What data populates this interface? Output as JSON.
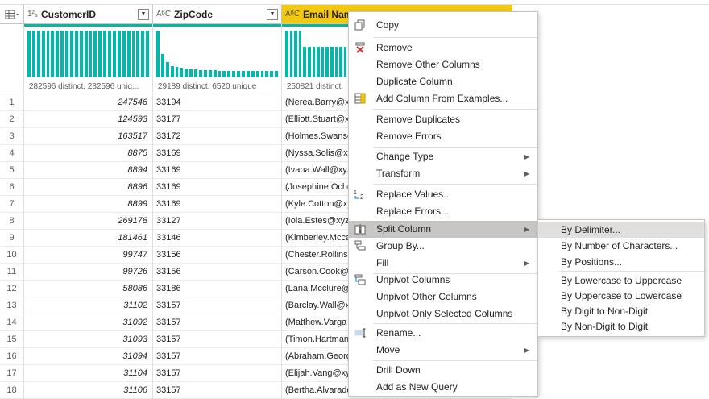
{
  "columns": [
    {
      "type_icon": "1²₃",
      "name": "CustomerID",
      "profile": "282596 distinct, 282596 uniq..."
    },
    {
      "type_icon": "AᴮC",
      "name": "ZipCode",
      "profile": "29189 distinct, 6520 unique"
    },
    {
      "type_icon": "AᴮC",
      "name": "Email Name",
      "profile": "250821 distinct, "
    }
  ],
  "rows": [
    {
      "n": "1",
      "id": "247546",
      "zip": "33194",
      "email": "(Nerea.Barry@xy"
    },
    {
      "n": "2",
      "id": "124593",
      "zip": "33177",
      "email": "(Elliott.Stuart@x"
    },
    {
      "n": "3",
      "id": "163517",
      "zip": "33172",
      "email": "(Holmes.Swanso"
    },
    {
      "n": "4",
      "id": "8875",
      "zip": "33169",
      "email": "(Nyssa.Solis@xyz"
    },
    {
      "n": "5",
      "id": "8894",
      "zip": "33169",
      "email": "(Ivana.Wall@xyz"
    },
    {
      "n": "6",
      "id": "8896",
      "zip": "33169",
      "email": "(Josephine.Ocho"
    },
    {
      "n": "7",
      "id": "8899",
      "zip": "33169",
      "email": "(Kyle.Cotton@xy"
    },
    {
      "n": "8",
      "id": "269178",
      "zip": "33127",
      "email": "(Iola.Estes@xyza"
    },
    {
      "n": "9",
      "id": "181461",
      "zip": "33146",
      "email": "(Kimberley.Mcca"
    },
    {
      "n": "10",
      "id": "99747",
      "zip": "33156",
      "email": "(Chester.Rollins@"
    },
    {
      "n": "11",
      "id": "99726",
      "zip": "33156",
      "email": "(Carson.Cook@x"
    },
    {
      "n": "12",
      "id": "58086",
      "zip": "33186",
      "email": "(Lana.Mcclure@"
    },
    {
      "n": "13",
      "id": "31102",
      "zip": "33157",
      "email": "(Barclay.Wall@x"
    },
    {
      "n": "14",
      "id": "31092",
      "zip": "33157",
      "email": "(Matthew.Varga"
    },
    {
      "n": "15",
      "id": "31093",
      "zip": "33157",
      "email": "(Timon.Hartman"
    },
    {
      "n": "16",
      "id": "31094",
      "zip": "33157",
      "email": "(Abraham.Georg"
    },
    {
      "n": "17",
      "id": "31104",
      "zip": "33157",
      "email": "(Elijah.Vang@xyz"
    },
    {
      "n": "18",
      "id": "31106",
      "zip": "33157",
      "email": "(Bertha.Alvarado"
    }
  ],
  "context_menu": {
    "copy": "Copy",
    "remove": "Remove",
    "remove_other_columns": "Remove Other Columns",
    "duplicate_column": "Duplicate Column",
    "add_column_from_examples": "Add Column From Examples...",
    "remove_duplicates": "Remove Duplicates",
    "remove_errors": "Remove Errors",
    "change_type": "Change Type",
    "transform": "Transform",
    "replace_values": "Replace Values...",
    "replace_errors": "Replace Errors...",
    "split_column": "Split Column",
    "group_by": "Group By...",
    "fill": "Fill",
    "unpivot_columns": "Unpivot Columns",
    "unpivot_other_columns": "Unpivot Other Columns",
    "unpivot_only_selected_columns": "Unpivot Only Selected Columns",
    "rename": "Rename...",
    "move": "Move",
    "drill_down": "Drill Down",
    "add_as_new_query": "Add as New Query"
  },
  "split_submenu": {
    "by_delimiter": "By Delimiter...",
    "by_number_of_characters": "By Number of Characters...",
    "by_positions": "By Positions...",
    "by_lowercase_to_uppercase": "By Lowercase to Uppercase",
    "by_uppercase_to_lowercase": "By Uppercase to Lowercase",
    "by_digit_to_non_digit": "By Digit to Non-Digit",
    "by_non_digit_to_digit": "By Non-Digit to Digit"
  },
  "colors": {
    "accent": "#f2c811",
    "profile_bar": "#01b8aa",
    "menu_highlight": "#c8c6c4"
  }
}
